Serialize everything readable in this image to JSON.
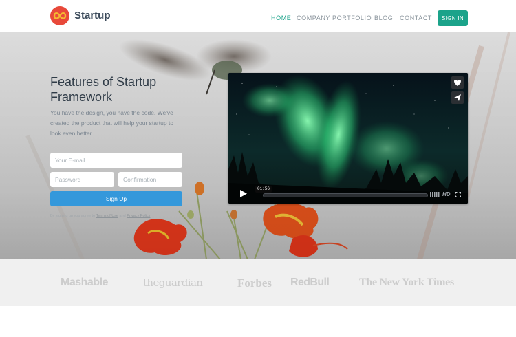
{
  "header": {
    "brand": "Startup",
    "nav": [
      "HOME",
      "COMPANY",
      "PORTFOLIO",
      "BLOG",
      "CONTACT"
    ],
    "signin_label": "SIGN IN"
  },
  "hero": {
    "title": "Features of Startup Framework",
    "description": "You have the design, you have the code. We've created the product that will help your startup to look even better.",
    "email_placeholder": "Your E-mail",
    "password_placeholder": "Password",
    "confirmation_placeholder": "Confirmation",
    "signup_label": "Sign Up",
    "terms_prefix": "By signing up you agree to",
    "terms_link": "Terms of Use",
    "terms_and": "and",
    "privacy_link": "Privacy Policy"
  },
  "video": {
    "time": "01:56",
    "quality": "HD",
    "icons": [
      "heart-icon",
      "send-icon",
      "play-icon",
      "volume-icon",
      "fullscreen-icon"
    ]
  },
  "press": [
    "Mashable",
    "theguardian",
    "Forbes",
    "RedBull",
    "The New York Times"
  ],
  "colors": {
    "accent": "#1ba38a",
    "signup": "#3498db",
    "logo": "#e8493a"
  }
}
